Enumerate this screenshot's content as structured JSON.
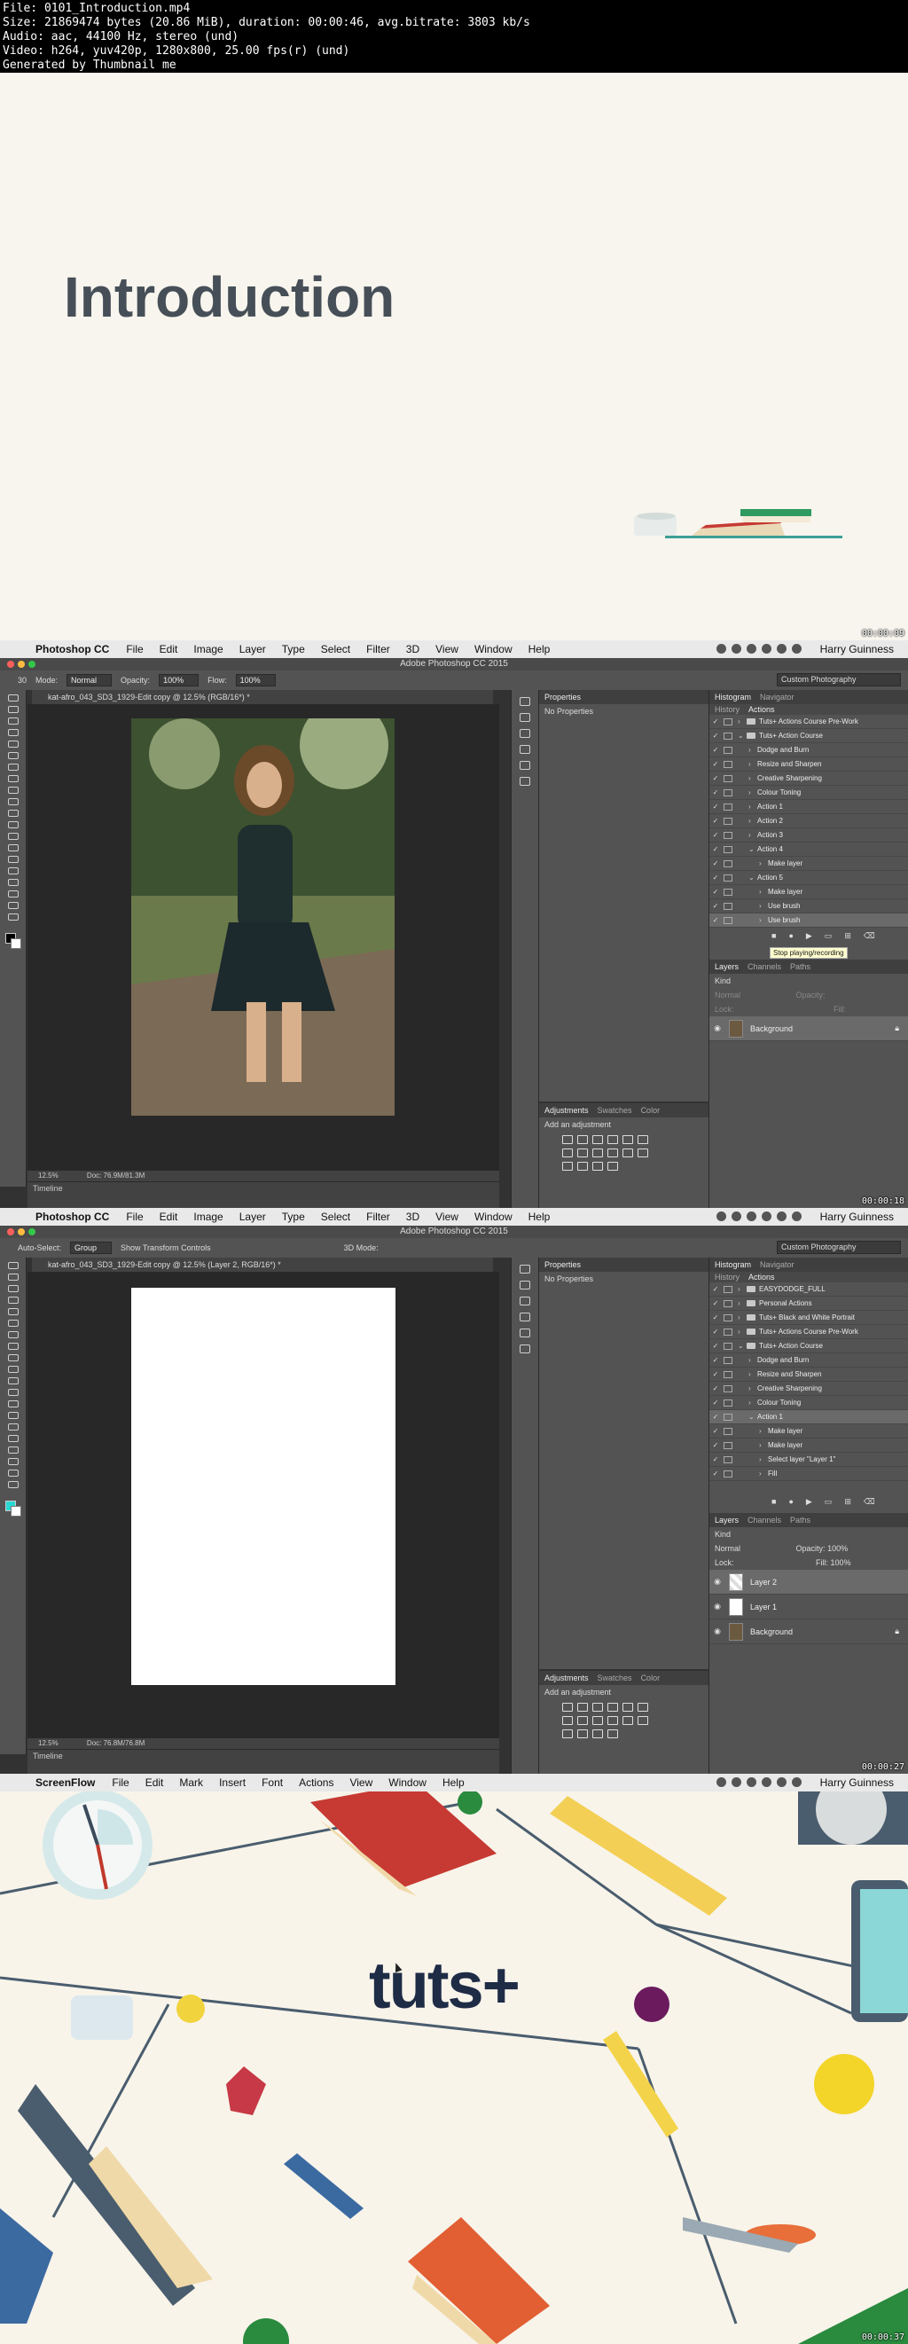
{
  "info_lines": [
    "File: 0101_Introduction.mp4",
    "Size: 21869474 bytes (20.86 MiB), duration: 00:00:46, avg.bitrate: 3803 kb/s",
    "Audio: aac, 44100 Hz, stereo (und)",
    "Video: h264, yuv420p, 1280x800, 25.00 fps(r) (und)",
    "Generated by Thumbnail me"
  ],
  "frame1": {
    "title": "Introduction",
    "timestamp": "00:00:09"
  },
  "frame2": {
    "timestamp": "00:00:18",
    "menubar": {
      "app": "Photoshop CC",
      "items": [
        "File",
        "Edit",
        "Image",
        "Layer",
        "Type",
        "Select",
        "Filter",
        "3D",
        "View",
        "Window",
        "Help"
      ],
      "user": "Harry Guinness"
    },
    "window_title": "Adobe Photoshop CC 2015",
    "options": {
      "mode_label": "Mode:",
      "mode": "Normal",
      "opacity_label": "Opacity:",
      "opacity": "100%",
      "flow_label": "Flow:",
      "flow": "100%",
      "brush_size": "30",
      "workspace": "Custom Photography"
    },
    "doc_tab": "kat-afro_043_SD3_1929-Edit copy @ 12.5% (RGB/16*) *",
    "status": {
      "zoom": "12.5%",
      "doc": "Doc: 76.9M/81.3M"
    },
    "timeline": "Timeline",
    "properties": {
      "tab": "Properties",
      "content": "No Properties"
    },
    "adjustments": {
      "tabs": [
        "Adjustments",
        "Swatches",
        "Color"
      ],
      "hint": "Add an adjustment"
    },
    "history_tabs": [
      "Histogram",
      "Navigator"
    ],
    "sub_tabs": [
      "History",
      "Actions"
    ],
    "actions": [
      {
        "label": "Tuts+ Actions Course Pre-Work",
        "level": 0,
        "type": "folder"
      },
      {
        "label": "Tuts+ Action Course",
        "level": 0,
        "type": "folder"
      },
      {
        "label": "Dodge and Burn",
        "level": 1,
        "type": "action"
      },
      {
        "label": "Resize and Sharpen",
        "level": 1,
        "type": "action"
      },
      {
        "label": "Creative Sharpening",
        "level": 1,
        "type": "action"
      },
      {
        "label": "Colour Toning",
        "level": 1,
        "type": "action"
      },
      {
        "label": "Action 1",
        "level": 1,
        "type": "action"
      },
      {
        "label": "Action 2",
        "level": 1,
        "type": "action"
      },
      {
        "label": "Action 3",
        "level": 1,
        "type": "action"
      },
      {
        "label": "Action 4",
        "level": 1,
        "type": "action"
      },
      {
        "label": "Make layer",
        "level": 2,
        "type": "step"
      },
      {
        "label": "Action 5",
        "level": 1,
        "type": "action"
      },
      {
        "label": "Make layer",
        "level": 2,
        "type": "step"
      },
      {
        "label": "Use brush",
        "level": 2,
        "type": "step"
      },
      {
        "label": "Use brush",
        "level": 2,
        "type": "step",
        "selected": true
      }
    ],
    "tooltip": "Stop playing/recording",
    "layers_tabs": [
      "Layers",
      "Channels",
      "Paths"
    ],
    "layer_kind": "Kind",
    "layer_mode": "Normal",
    "layer_opacity_label": "Opacity:",
    "lock_label": "Lock:",
    "fill_label": "Fill:",
    "layers": [
      {
        "name": "Background",
        "selected": true
      }
    ]
  },
  "frame3": {
    "timestamp": "00:00:27",
    "menubar": {
      "app": "Photoshop CC",
      "items": [
        "File",
        "Edit",
        "Image",
        "Layer",
        "Type",
        "Select",
        "Filter",
        "3D",
        "View",
        "Window",
        "Help"
      ],
      "user": "Harry Guinness"
    },
    "window_title": "Adobe Photoshop CC 2015",
    "options": {
      "auto_select": "Auto-Select:",
      "group": "Group",
      "transform": "Show Transform Controls",
      "mode3d": "3D Mode:",
      "workspace": "Custom Photography"
    },
    "doc_tab": "kat-afro_043_SD3_1929-Edit copy @ 12.5% (Layer 2, RGB/16*) *",
    "status": {
      "zoom": "12.5%",
      "doc": "Doc: 76.8M/76.8M"
    },
    "timeline": "Timeline",
    "properties": {
      "tab": "Properties",
      "content": "No Properties"
    },
    "adjustments": {
      "tabs": [
        "Adjustments",
        "Swatches",
        "Color"
      ],
      "hint": "Add an adjustment"
    },
    "history_tabs": [
      "Histogram",
      "Navigator"
    ],
    "sub_tabs": [
      "History",
      "Actions"
    ],
    "actions": [
      {
        "label": "EASYDODGE_FULL",
        "level": 0,
        "type": "folder"
      },
      {
        "label": "Personal Actions",
        "level": 0,
        "type": "folder"
      },
      {
        "label": "Tuts+ Black and White Portrait",
        "level": 0,
        "type": "folder"
      },
      {
        "label": "Tuts+ Actions Course Pre-Work",
        "level": 0,
        "type": "folder"
      },
      {
        "label": "Tuts+ Action Course",
        "level": 0,
        "type": "folder"
      },
      {
        "label": "Dodge and Burn",
        "level": 1,
        "type": "action"
      },
      {
        "label": "Resize and Sharpen",
        "level": 1,
        "type": "action"
      },
      {
        "label": "Creative Sharpening",
        "level": 1,
        "type": "action"
      },
      {
        "label": "Colour Toning",
        "level": 1,
        "type": "action"
      },
      {
        "label": "Action 1",
        "level": 1,
        "type": "action",
        "selected": true
      },
      {
        "label": "Make layer",
        "level": 2,
        "type": "step"
      },
      {
        "label": "Make layer",
        "level": 2,
        "type": "step"
      },
      {
        "label": "Select layer \"Layer 1\"",
        "level": 2,
        "type": "step"
      },
      {
        "label": "Fill",
        "level": 2,
        "type": "step"
      }
    ],
    "layers_tabs": [
      "Layers",
      "Channels",
      "Paths"
    ],
    "layer_kind": "Kind",
    "layer_mode": "Normal",
    "layer_opacity_label": "Opacity:",
    "layer_opacity": "100%",
    "lock_label": "Lock:",
    "fill_label": "Fill:",
    "fill": "100%",
    "layers": [
      {
        "name": "Layer 2",
        "selected": true
      },
      {
        "name": "Layer 1"
      },
      {
        "name": "Background"
      }
    ]
  },
  "frame4": {
    "timestamp": "00:00:37",
    "menubar": {
      "app": "ScreenFlow",
      "items": [
        "File",
        "Edit",
        "Mark",
        "Insert",
        "Font",
        "Actions",
        "View",
        "Window",
        "Help"
      ],
      "user": "Harry Guinness"
    },
    "logo": "tuts+"
  },
  "colors": {
    "ps_bg": "#535353",
    "canvas_bg": "#282828",
    "logo": "#1f2c46",
    "cream": "#f8f5ee"
  }
}
